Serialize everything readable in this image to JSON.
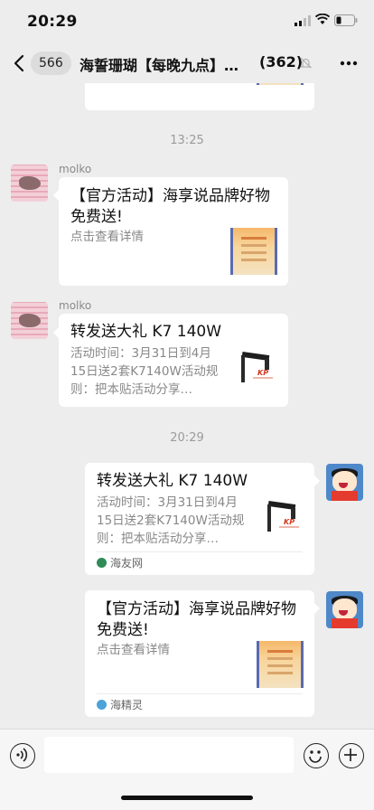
{
  "status": {
    "time": "20:29"
  },
  "nav": {
    "unread": "566",
    "title": "海誓珊瑚【每晚九点】…",
    "members": "(362)"
  },
  "timestamps": {
    "t1": "13:25",
    "t2": "20:29"
  },
  "messages": [
    {
      "sender": "molko",
      "title": "【官方活动】海享说品牌好物免费送!",
      "desc": "点击查看详情"
    },
    {
      "sender": "molko",
      "title": "转发送大礼 K7 140W",
      "desc": "活动时间：3月31日到4月15日送2套K7140W活动规则：把本贴活动分享…"
    },
    {
      "title": "转发送大礼 K7 140W",
      "desc": "活动时间：3月31日到4月15日送2套K7140W活动规则：把本贴活动分享…",
      "source": "海友网"
    },
    {
      "title": "【官方活动】海享说品牌好物免费送!",
      "desc": "点击查看详情",
      "source": "海精灵"
    }
  ],
  "product_brand": "KP",
  "colors": {
    "background": "#ededed",
    "bubble": "#ffffff",
    "meta_text": "#9b9b9b",
    "source_green": "#2e8b57"
  },
  "icons": [
    "back-icon",
    "signal-icon",
    "wifi-icon",
    "battery-icon",
    "mute-icon",
    "more-icon",
    "voice-icon",
    "emoji-icon",
    "add-icon"
  ]
}
